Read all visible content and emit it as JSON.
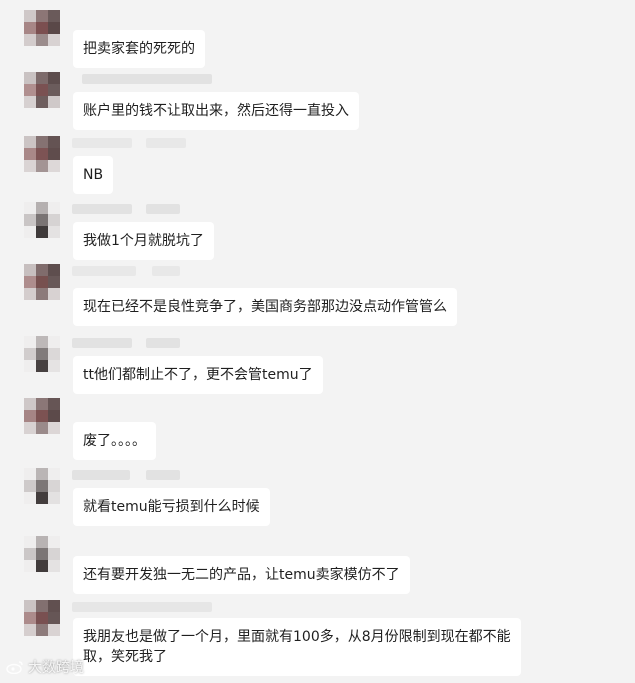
{
  "messages": [
    {
      "text": "把卖家套的死死的",
      "avatar": "dark"
    },
    {
      "text": "账户里的钱不让取出来，然后还得一直投入",
      "avatar": "dark"
    },
    {
      "text": "NB",
      "avatar": "dark"
    },
    {
      "text": "我做1个月就脱坑了",
      "avatar": "light"
    },
    {
      "text": "现在已经不是良性竞争了，美国商务部那边没点动作管管么",
      "avatar": "dark"
    },
    {
      "text": "tt他们都制止不了，更不会管temu了",
      "avatar": "light"
    },
    {
      "text": "废了。。。。",
      "avatar": "dark"
    },
    {
      "text": "就看temu能亏损到什么时候",
      "avatar": "light"
    },
    {
      "text": "还有要开发独一无二的产品，让temu卖家模仿不了",
      "avatar": "light"
    },
    {
      "text": "我朋友也是做了一个月，里面就有100多，从8月份限制到现在都不能\n取，笑死我了",
      "avatar": "dark"
    }
  ],
  "watermark": {
    "text": "大数跨境",
    "icon": "weibo-logo-icon"
  },
  "colors": {
    "background": "#f3f3f3",
    "bubble": "#ffffff",
    "text": "#1f1f1f"
  }
}
